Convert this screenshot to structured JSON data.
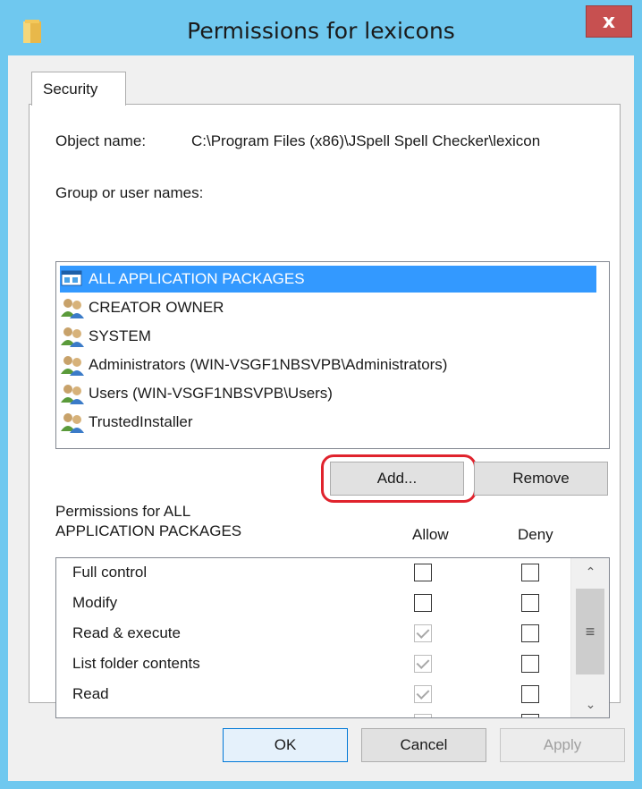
{
  "window": {
    "title": "Permissions for lexicons",
    "close_label": "x"
  },
  "tabs": [
    {
      "label": "Security"
    }
  ],
  "object": {
    "label": "Object name:",
    "value": "C:\\Program Files (x86)\\JSpell Spell Checker\\lexicon"
  },
  "groups": {
    "label": "Group or user names:",
    "items": [
      {
        "label": "ALL APPLICATION PACKAGES",
        "icon": "app-packages-icon",
        "selected": true
      },
      {
        "label": "CREATOR OWNER",
        "icon": "users-group-icon",
        "selected": false
      },
      {
        "label": "SYSTEM",
        "icon": "users-group-icon",
        "selected": false
      },
      {
        "label": "Administrators (WIN-VSGF1NBSVPB\\Administrators)",
        "icon": "users-group-icon",
        "selected": false
      },
      {
        "label": "Users (WIN-VSGF1NBSVPB\\Users)",
        "icon": "users-group-icon",
        "selected": false
      },
      {
        "label": "TrustedInstaller",
        "icon": "users-group-icon",
        "selected": false
      }
    ]
  },
  "buttons": {
    "add": "Add...",
    "remove": "Remove",
    "ok": "OK",
    "cancel": "Cancel",
    "apply": "Apply"
  },
  "permissions": {
    "label_line1": "Permissions for ALL",
    "label_line2": "APPLICATION PACKAGES",
    "allow_header": "Allow",
    "deny_header": "Deny",
    "rows": [
      {
        "name": "Full control",
        "allow": false,
        "deny": false
      },
      {
        "name": "Modify",
        "allow": false,
        "deny": false
      },
      {
        "name": "Read & execute",
        "allow": true,
        "deny": false
      },
      {
        "name": "List folder contents",
        "allow": true,
        "deny": false
      },
      {
        "name": "Read",
        "allow": true,
        "deny": false
      }
    ]
  },
  "colors": {
    "titlebar": "#6fc8ef",
    "close": "#c75050",
    "selection": "#3399ff",
    "highlight_ring": "#e0232d"
  }
}
